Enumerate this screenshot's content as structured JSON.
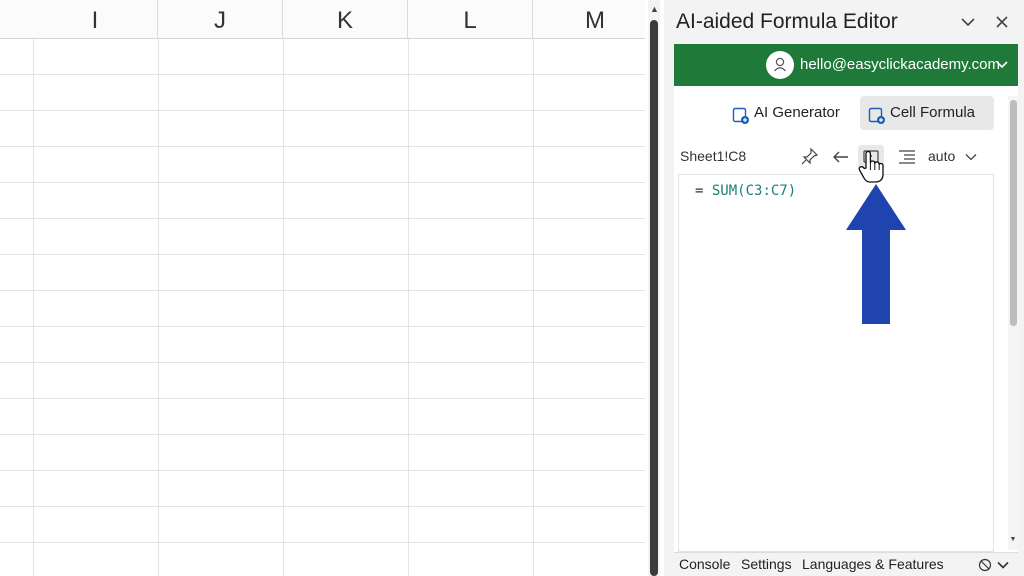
{
  "spreadsheet": {
    "columns": [
      "I",
      "J",
      "K",
      "L",
      "M"
    ]
  },
  "panel": {
    "title": "AI-aided Formula Editor",
    "account": {
      "email": "hello@easyclickacademy.com"
    },
    "modes": [
      {
        "label": "AI Generator",
        "selected": false
      },
      {
        "label": "Cell Formula",
        "selected": true
      }
    ],
    "toolbar": {
      "cell_ref": "Sheet1!C8",
      "auto_label": "auto",
      "icons": [
        "pin-icon",
        "arrow-left-icon",
        "format-icon",
        "align-right-icon",
        "chevron-down-icon"
      ]
    },
    "editor": {
      "prefix": "= ",
      "function": "SUM",
      "args": "(C3:C7)"
    },
    "bottom_tabs": [
      "Console",
      "Settings",
      "Languages & Features"
    ]
  },
  "colors": {
    "account_bar": "#1f7a3a",
    "annotation_arrow": "#1f44b0",
    "formula_function": "#1a7f7a"
  }
}
